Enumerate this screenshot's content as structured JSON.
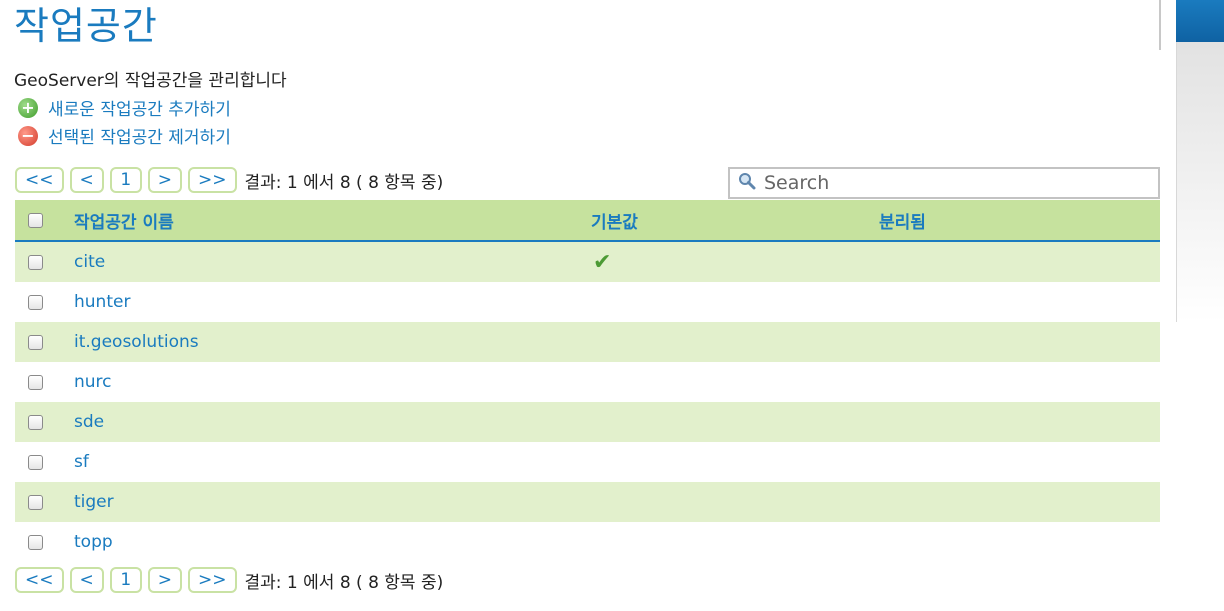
{
  "page": {
    "title": "작업공간",
    "description": "GeoServer의 작업공간을 관리합니다",
    "add_action": "새로운 작업공간 추가하기",
    "remove_action": "선택된 작업공간 제거하기"
  },
  "pager": {
    "first": "<<",
    "prev": "<",
    "page": "1",
    "next": ">",
    "last": ">>",
    "info": "결과: 1 에서 8 ( 8 항목 중)"
  },
  "search": {
    "placeholder": "Search",
    "icon": "magnifier-icon"
  },
  "table": {
    "headers": {
      "name": "작업공간 이름",
      "default": "기본값",
      "isolated": "분리됨"
    },
    "rows": [
      {
        "name": "cite",
        "default": true
      },
      {
        "name": "hunter",
        "default": false
      },
      {
        "name": "it.geosolutions",
        "default": false
      },
      {
        "name": "nurc",
        "default": false
      },
      {
        "name": "sde",
        "default": false
      },
      {
        "name": "sf",
        "default": false
      },
      {
        "name": "tiger",
        "default": false
      },
      {
        "name": "topp",
        "default": false
      }
    ]
  },
  "colors": {
    "accent": "#1a7bbf",
    "header_bg": "#c6e29e",
    "row_alt": "#e2f0cc",
    "pager_border": "#c9e2a4"
  }
}
